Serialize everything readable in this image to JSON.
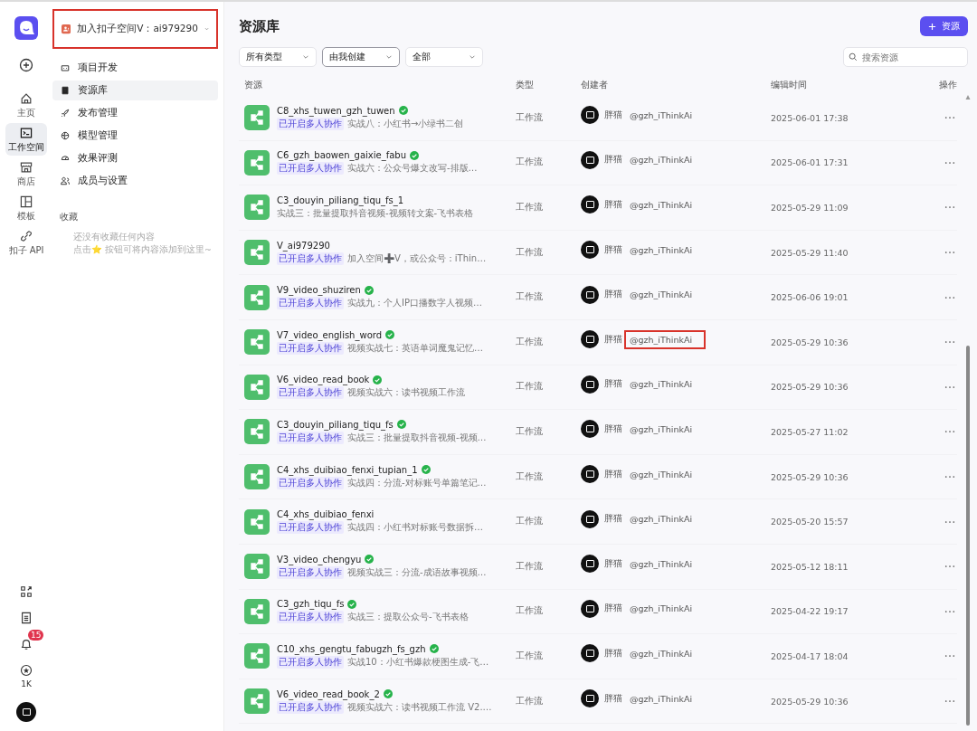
{
  "rail": {
    "items": [
      {
        "label": "主页",
        "selected": false
      },
      {
        "label": "工作空间",
        "selected": true
      },
      {
        "label": "商店",
        "selected": false
      },
      {
        "label": "模板",
        "selected": false
      },
      {
        "label": "扣子 API",
        "selected": false
      }
    ],
    "notification_badge": "15",
    "favorites_count": "1K"
  },
  "sidebar": {
    "workspace": {
      "label": "加入扣子空间V：ai979290",
      "highlight": true
    },
    "items": [
      {
        "label": "项目开发",
        "selected": false
      },
      {
        "label": "资源库",
        "selected": true
      },
      {
        "label": "发布管理",
        "selected": false
      },
      {
        "label": "模型管理",
        "selected": false
      },
      {
        "label": "效果评测",
        "selected": false
      },
      {
        "label": "成员与设置",
        "selected": false
      }
    ],
    "favorites_title": "收藏",
    "favorites_empty": [
      "还没有收藏任何内容",
      "点击⭐ 按钮可将内容添加到这里~"
    ]
  },
  "page": {
    "title": "资源库",
    "add_button": "资源",
    "filters": [
      {
        "value": "所有类型",
        "focused": false
      },
      {
        "value": "由我创建",
        "focused": true
      },
      {
        "value": "全部",
        "focused": false
      }
    ],
    "search": {
      "placeholder": "搜索资源"
    }
  },
  "table": {
    "columns": [
      "资源",
      "类型",
      "创建者",
      "编辑时间",
      "操作"
    ],
    "rows": [
      {
        "name": "C8_xhs_tuwen_gzh_tuwen",
        "verified": true,
        "tag": "已开启多人协作",
        "desc": "实战八：小红书→小绿书二创",
        "type": "工作流",
        "creator": "胖猫",
        "handle": "@gzh_iThinkAi",
        "highlight": false,
        "time": "2025-06-01 17:38"
      },
      {
        "name": "C6_gzh_baowen_gaixie_fabu",
        "verified": true,
        "tag": "已开启多人协作",
        "desc": "实战六：公众号爆文改写-排版…",
        "type": "工作流",
        "creator": "胖猫",
        "handle": "@gzh_iThinkAi",
        "highlight": false,
        "time": "2025-06-01 17:31"
      },
      {
        "name": "C3_douyin_piliang_tiqu_fs_1",
        "verified": false,
        "desc": "实战三：批量提取抖音视频-视频转文案-飞书表格",
        "type": "工作流",
        "creator": "胖猫",
        "handle": "@gzh_iThinkAi",
        "highlight": false,
        "time": "2025-05-29 11:09"
      },
      {
        "name": "V_ai979290",
        "verified": false,
        "tag": "已开启多人协作",
        "desc": "加入空间➕V，或公众号：iThin…",
        "type": "工作流",
        "creator": "胖猫",
        "handle": "@gzh_iThinkAi",
        "highlight": false,
        "time": "2025-05-29 11:40"
      },
      {
        "name": "V9_video_shuziren",
        "verified": true,
        "tag": "已开启多人协作",
        "desc": "实战九：个人IP口播数字人视频…",
        "type": "工作流",
        "creator": "胖猫",
        "handle": "@gzh_iThinkAi",
        "highlight": false,
        "time": "2025-06-06 19:01"
      },
      {
        "name": "V7_video_english_word",
        "verified": true,
        "tag": "已开启多人协作",
        "desc": "视频实战七：英语单词魔鬼记忆…",
        "type": "工作流",
        "creator": "胖猫",
        "handle": "@gzh_iThinkAi",
        "highlight": true,
        "time": "2025-05-29 10:36"
      },
      {
        "name": "V6_video_read_book",
        "verified": true,
        "tag": "已开启多人协作",
        "desc": "视频实战六：读书视频工作流",
        "type": "工作流",
        "creator": "胖猫",
        "handle": "@gzh_iThinkAi",
        "highlight": false,
        "time": "2025-05-29 10:36"
      },
      {
        "name": "C3_douyin_piliang_tiqu_fs",
        "verified": true,
        "tag": "已开启多人协作",
        "desc": "实战三：批量提取抖音视频-视频…",
        "type": "工作流",
        "creator": "胖猫",
        "handle": "@gzh_iThinkAi",
        "highlight": false,
        "time": "2025-05-27 11:02"
      },
      {
        "name": "C4_xhs_duibiao_fenxi_tupian_1",
        "verified": true,
        "tag": "已开启多人协作",
        "desc": "实战四：分流-对标账号单篇笔记…",
        "type": "工作流",
        "creator": "胖猫",
        "handle": "@gzh_iThinkAi",
        "highlight": false,
        "time": "2025-05-29 10:36"
      },
      {
        "name": "C4_xhs_duibiao_fenxi",
        "verified": false,
        "tag": "已开启多人协作",
        "desc": "实战四：小红书对标账号数据拆…",
        "type": "工作流",
        "creator": "胖猫",
        "handle": "@gzh_iThinkAi",
        "highlight": false,
        "time": "2025-05-20 15:57"
      },
      {
        "name": "V3_video_chengyu",
        "verified": true,
        "tag": "已开启多人协作",
        "desc": "视频实战三：分流-成语故事视频…",
        "type": "工作流",
        "creator": "胖猫",
        "handle": "@gzh_iThinkAi",
        "highlight": false,
        "time": "2025-05-12 18:11"
      },
      {
        "name": "C3_gzh_tiqu_fs",
        "verified": true,
        "tag": "已开启多人协作",
        "desc": "实战三：提取公众号-飞书表格",
        "type": "工作流",
        "creator": "胖猫",
        "handle": "@gzh_iThinkAi",
        "highlight": false,
        "time": "2025-04-22 19:17"
      },
      {
        "name": "C10_xhs_gengtu_fabugzh_fs_gzh",
        "verified": true,
        "tag": "已开启多人协作",
        "desc": "实战10：小红书爆款梗图生成-飞…",
        "type": "工作流",
        "creator": "胖猫",
        "handle": "@gzh_iThinkAi",
        "highlight": false,
        "time": "2025-04-17 18:04"
      },
      {
        "name": "V6_video_read_book_2",
        "verified": true,
        "tag": "已开启多人协作",
        "desc": "视频实战六：读书视频工作流 V2.…",
        "type": "工作流",
        "creator": "胖猫",
        "handle": "@gzh_iThinkAi",
        "highlight": false,
        "time": "2025-05-29 10:36"
      }
    ]
  }
}
